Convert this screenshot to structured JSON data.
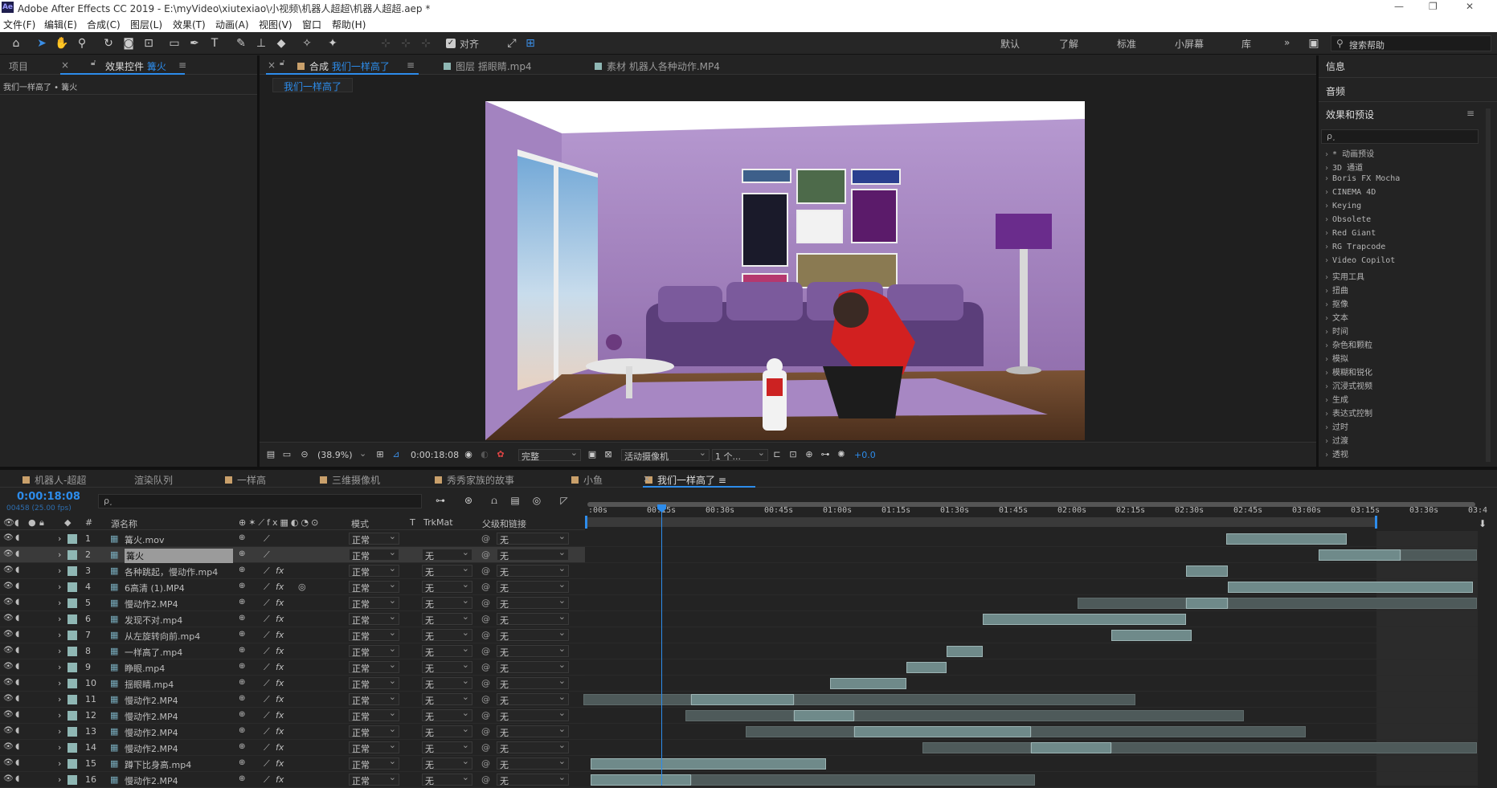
{
  "window": {
    "title": "Adobe After Effects CC 2019 - E:\\myVideo\\xiutexiao\\小视频\\机器人超超\\机器人超超.aep *",
    "logo": "Ae"
  },
  "menu": [
    "文件(F)",
    "编辑(E)",
    "合成(C)",
    "图层(L)",
    "效果(T)",
    "动画(A)",
    "视图(V)",
    "窗口",
    "帮助(H)"
  ],
  "toolbar": {
    "snap_label": "对齐",
    "workspaces": [
      "默认",
      "了解",
      "标准",
      "小屏幕",
      "库"
    ],
    "search_placeholder": "搜索帮助",
    "overflow": "»"
  },
  "left_panel": {
    "tab_project": "项目",
    "tab_effects_prefix": "效果控件",
    "tab_effects_layer": "篝火",
    "breadcrumb": "我们一样高了 • 篝火"
  },
  "comp_panel": {
    "tab_comp_prefix": "合成",
    "tab_comp_name": "我们一样高了",
    "tab_layer": "图层 揺眼睛.mp4",
    "tab_footage": "素材 机器人各种动作.MP4",
    "comp_chip": "我们一样高了"
  },
  "viewer_bar": {
    "zoom": "(38.9%)",
    "timecode": "0:00:18:08",
    "quality": "完整",
    "camera": "活动摄像机",
    "views": "1 个...",
    "exposure": "+0.0"
  },
  "right_panel": {
    "info": "信息",
    "audio": "音频",
    "effects_title": "效果和预设",
    "search_placeholder": "ρ˯",
    "items": [
      "* 动画预设",
      "3D 通道",
      "Boris FX Mocha",
      "CINEMA 4D",
      "Keying",
      "Obsolete",
      "Red Giant",
      "RG Trapcode",
      "Video Copilot",
      "实用工具",
      "扭曲",
      "抠像",
      "文本",
      "时间",
      "杂色和颗粒",
      "模拟",
      "模糊和锐化",
      "沉浸式视频",
      "生成",
      "表达式控制",
      "过时",
      "过渡",
      "透视"
    ]
  },
  "timeline_tabs": [
    "机器人-超超",
    "渲染队列",
    "一样高",
    "三维摄像机",
    "秀秀家族的故事",
    "小鱼",
    "我们一样高了"
  ],
  "timeline": {
    "timecode": "0:00:18:08",
    "frame_info": "00458 (25.00 fps)",
    "search_placeholder": "ρ˯",
    "headers": {
      "num": "#",
      "source": "源名称",
      "mode": "模式",
      "t": "T",
      "trkmat": "TrkMat",
      "parent": "父级和链接"
    },
    "ruler": [
      ":00s",
      "00:15s",
      "00:30s",
      "00:45s",
      "01:00s",
      "01:15s",
      "01:30s",
      "01:45s",
      "02:00s",
      "02:15s",
      "02:30s",
      "02:45s",
      "03:00s",
      "03:15s",
      "03:30s",
      "03:4"
    ],
    "layers": [
      {
        "num": "1",
        "name": "篝火.mov",
        "mode": "正常",
        "trk": "",
        "parent": "无"
      },
      {
        "num": "2",
        "name": "篝火",
        "mode": "正常",
        "trk": "无",
        "parent": "无"
      },
      {
        "num": "3",
        "name": "各种跳起，慢动作.mp4",
        "mode": "正常",
        "trk": "无",
        "parent": "无"
      },
      {
        "num": "4",
        "name": "6高清 (1).MP4",
        "mode": "正常",
        "trk": "无",
        "parent": "无"
      },
      {
        "num": "5",
        "name": "慢动作2.MP4",
        "mode": "正常",
        "trk": "无",
        "parent": "无"
      },
      {
        "num": "6",
        "name": "发现不对.mp4",
        "mode": "正常",
        "trk": "无",
        "parent": "无"
      },
      {
        "num": "7",
        "name": "从左旋转向前.mp4",
        "mode": "正常",
        "trk": "无",
        "parent": "无"
      },
      {
        "num": "8",
        "name": "一样高了.mp4",
        "mode": "正常",
        "trk": "无",
        "parent": "无"
      },
      {
        "num": "9",
        "name": "睁眼.mp4",
        "mode": "正常",
        "trk": "无",
        "parent": "无"
      },
      {
        "num": "10",
        "name": "揺眼睛.mp4",
        "mode": "正常",
        "trk": "无",
        "parent": "无"
      },
      {
        "num": "11",
        "name": "慢动作2.MP4",
        "mode": "正常",
        "trk": "无",
        "parent": "无"
      },
      {
        "num": "12",
        "name": "慢动作2.MP4",
        "mode": "正常",
        "trk": "无",
        "parent": "无"
      },
      {
        "num": "13",
        "name": "慢动作2.MP4",
        "mode": "正常",
        "trk": "无",
        "parent": "无"
      },
      {
        "num": "14",
        "name": "慢动作2.MP4",
        "mode": "正常",
        "trk": "无",
        "parent": "无"
      },
      {
        "num": "15",
        "name": "蹲下比身高.mp4",
        "mode": "正常",
        "trk": "无",
        "parent": "无"
      },
      {
        "num": "16",
        "name": "慢动作2.MP4",
        "mode": "正常",
        "trk": "无",
        "parent": "无"
      }
    ]
  },
  "colors": {
    "accent": "#2d8ceb",
    "bg": "#232323",
    "label_teal": "#8fb7b4",
    "label_tan": "#c9a06b",
    "clip": "#6f8a8a"
  }
}
